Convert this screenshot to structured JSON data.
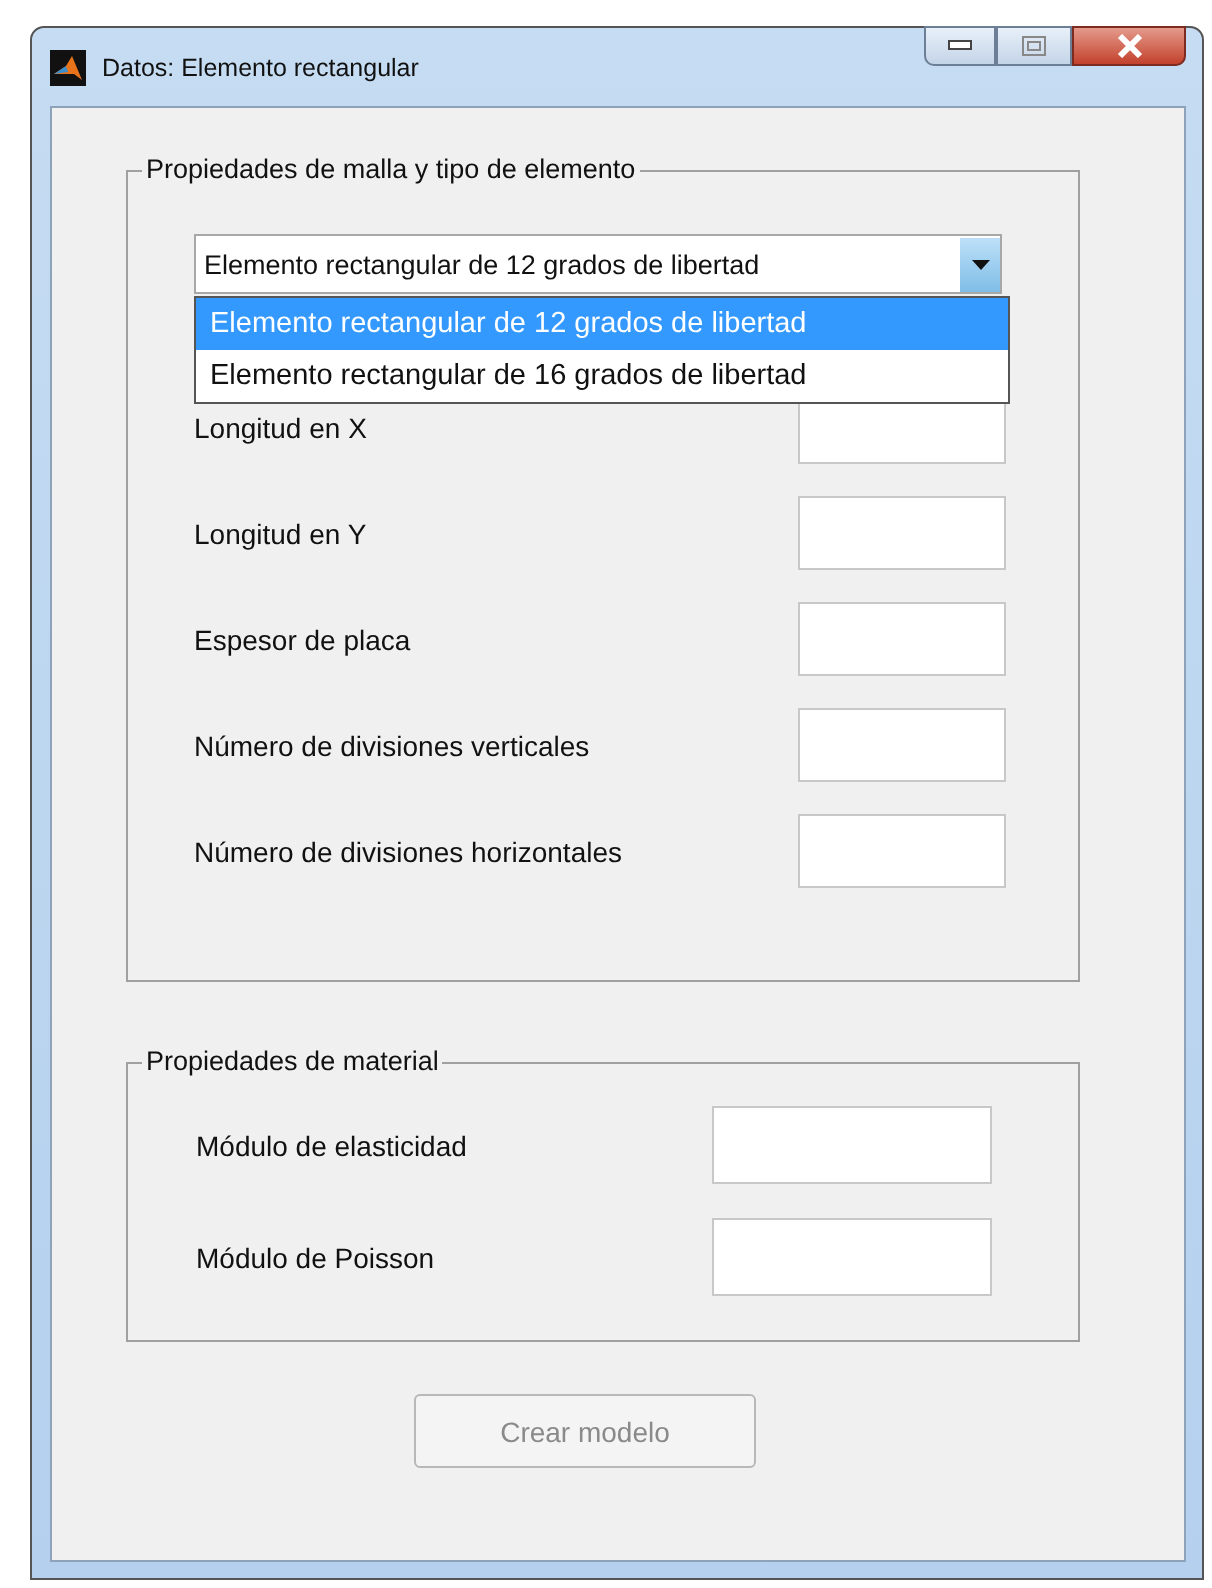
{
  "window": {
    "title": "Datos: Elemento rectangular"
  },
  "mesh_panel": {
    "title": "Propiedades de malla y tipo de elemento",
    "element_type": {
      "value": "Elemento rectangular de 12 grados de libertad",
      "expanded": true,
      "options": [
        {
          "label": "Elemento rectangular de 12 grados de libertad",
          "selected": true
        },
        {
          "label": "Elemento rectangular de 16 grados de libertad",
          "selected": false
        }
      ]
    },
    "fields": [
      {
        "label": "Longitud en X"
      },
      {
        "label": "Longitud en Y"
      },
      {
        "label": "Espesor de placa"
      },
      {
        "label": "Número de divisiones verticales"
      },
      {
        "label": "Número de divisiones horizontales"
      }
    ]
  },
  "material_panel": {
    "title": "Propiedades de material",
    "fields": [
      {
        "label": "Módulo de elasticidad"
      },
      {
        "label": "Módulo de Poisson"
      }
    ]
  },
  "create_button": {
    "label": "Crear modelo",
    "disabled": true
  }
}
